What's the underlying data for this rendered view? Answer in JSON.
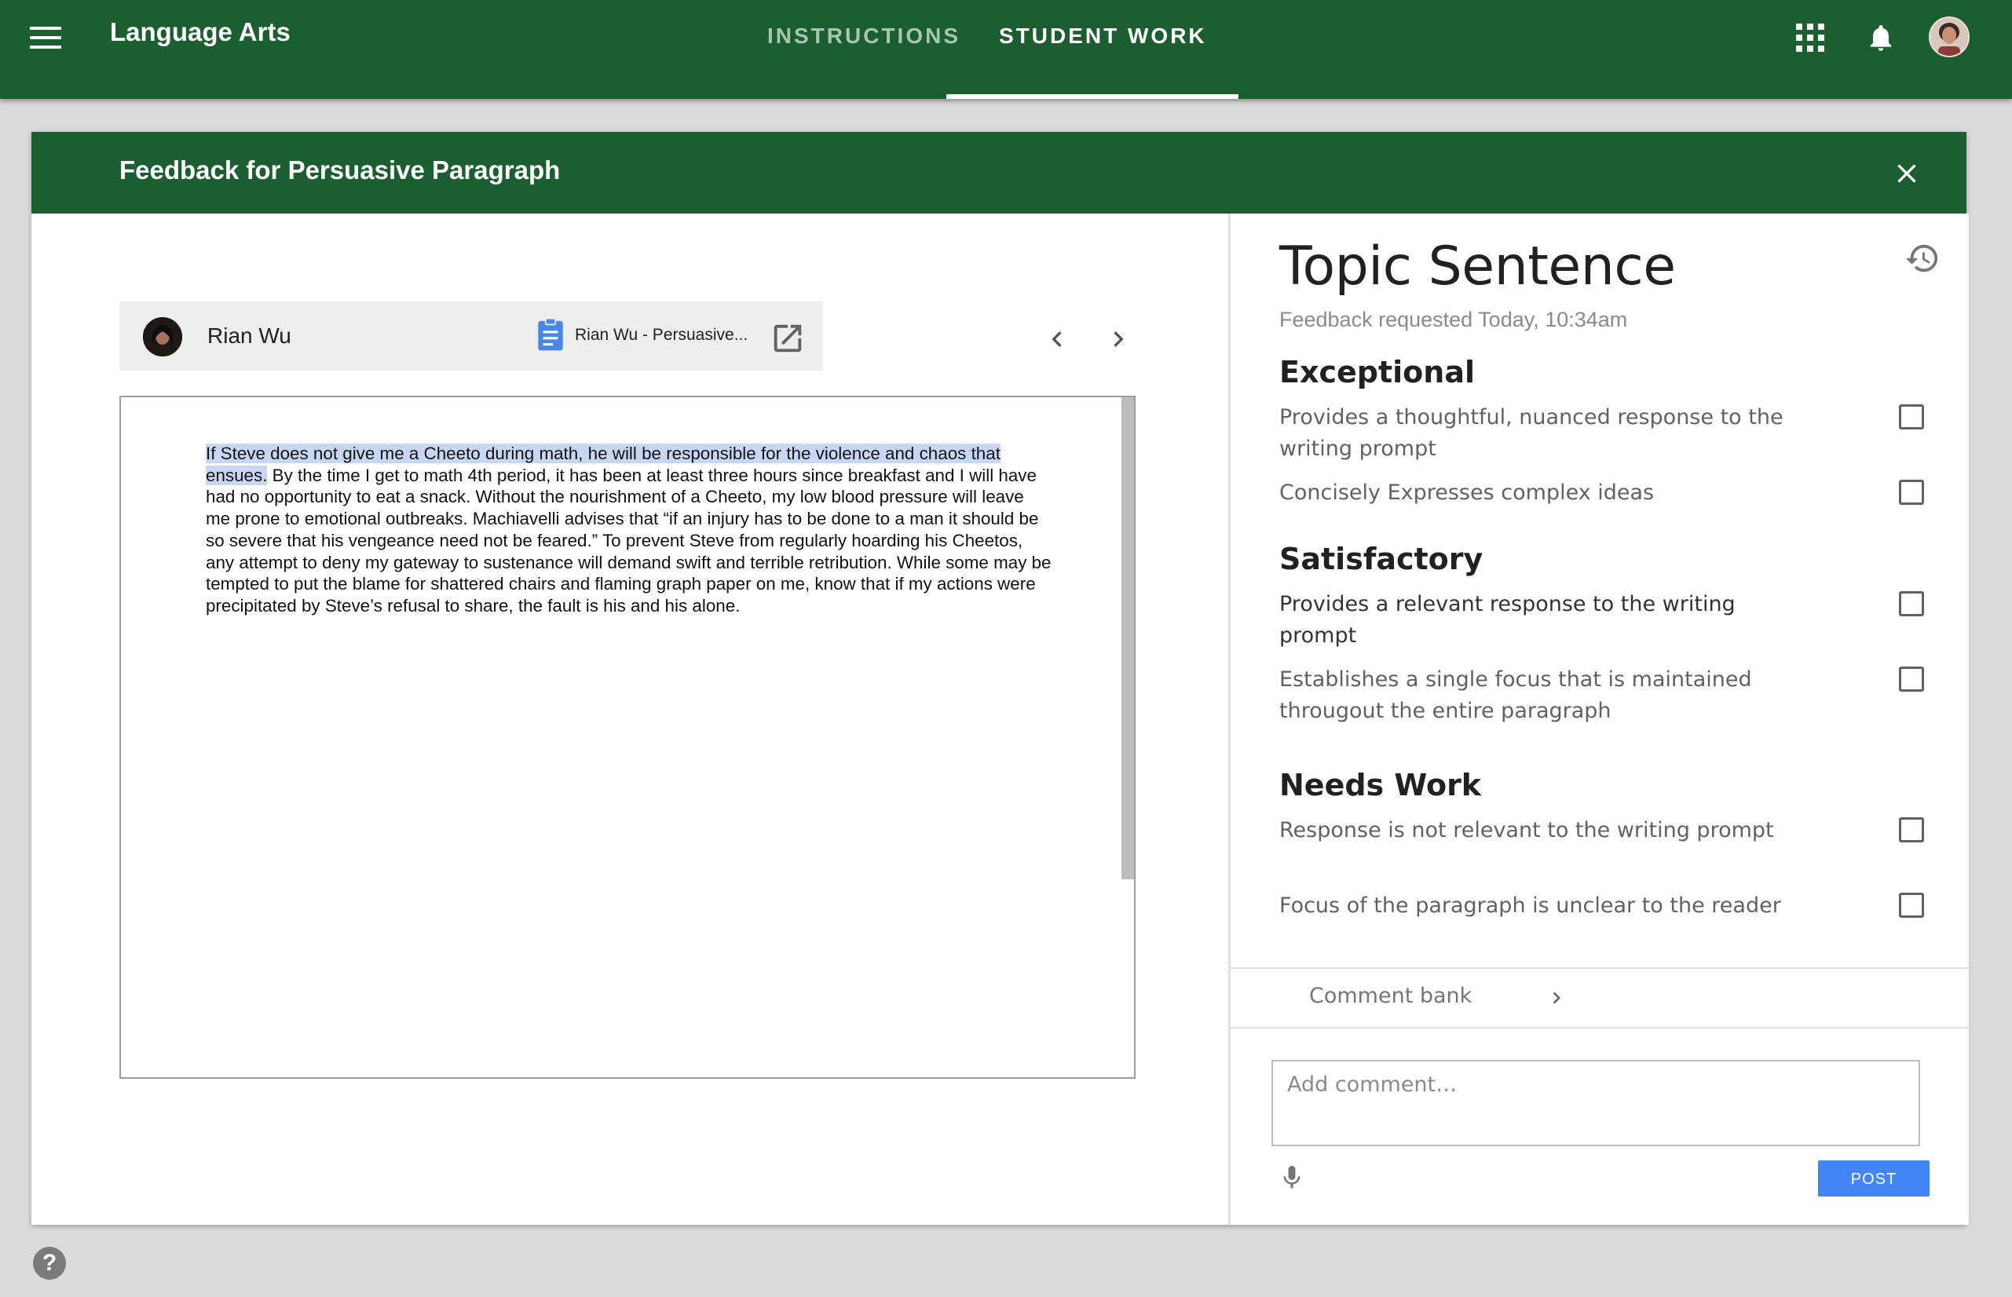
{
  "app": {
    "title": "Language Arts",
    "tabs": [
      {
        "label": "INSTRUCTIONS",
        "active": false
      },
      {
        "label": "STUDENT WORK",
        "active": true
      }
    ],
    "icons": [
      "menu-icon",
      "apps-grid-icon",
      "bell-icon",
      "user-avatar"
    ]
  },
  "dialog": {
    "title": "Feedback for Persuasive Paragraph",
    "close_icon": "close-icon"
  },
  "student": {
    "name": "Rian Wu",
    "doc_name": "Rian Wu - Persuasive..."
  },
  "document": {
    "highlighted": "If Steve does not give me a Cheeto during math, he will be responsible for the violence and chaos that ensues.",
    "rest": " By the time I get to math 4th period, it has been at least three hours since breakfast and I will have had no opportunity to eat a snack. Without the nourishment of a Cheeto, my low blood pressure will leave me prone to emotional outbreaks. Machiavelli advises that “if an injury has to be done to a man it should be so severe that his vengeance need not be feared.” To prevent Steve from regularly hoarding his Cheetos, any attempt to deny my gateway to sustenance will demand swift and terrible retribution. While some may be tempted to put the blame for shattered chairs and flaming graph paper on me, know that if my actions were precipitated by Steve’s refusal to share, the fault is his and his alone."
  },
  "rubric": {
    "title": "Topic Sentence",
    "subtitle": "Feedback requested Today, 10:34am",
    "levels": [
      {
        "name": "Exceptional",
        "criteria": [
          {
            "text": "Provides a thoughtful, nuanced response to the writing prompt",
            "checked": false
          },
          {
            "text": "Concisely Expresses complex ideas",
            "checked": false
          }
        ]
      },
      {
        "name": "Satisfactory",
        "criteria": [
          {
            "text": "Provides a relevant response to the writing prompt",
            "checked": false
          },
          {
            "text": "Establishes a single focus that is maintained througout the entire paragraph",
            "checked": false
          }
        ]
      },
      {
        "name": "Needs Work",
        "criteria": [
          {
            "text": "Response is not relevant to the writing prompt",
            "checked": false
          },
          {
            "text": "Focus of the paragraph is unclear to the reader",
            "checked": false
          }
        ]
      }
    ]
  },
  "comments": {
    "bank_label": "Comment bank",
    "placeholder": "Add comment…",
    "post_label": "POST"
  },
  "help": {
    "label": "?"
  },
  "colors": {
    "brand_green": "#1b5e30",
    "post_blue": "#4285f4",
    "highlight": "#c6d6f3"
  }
}
